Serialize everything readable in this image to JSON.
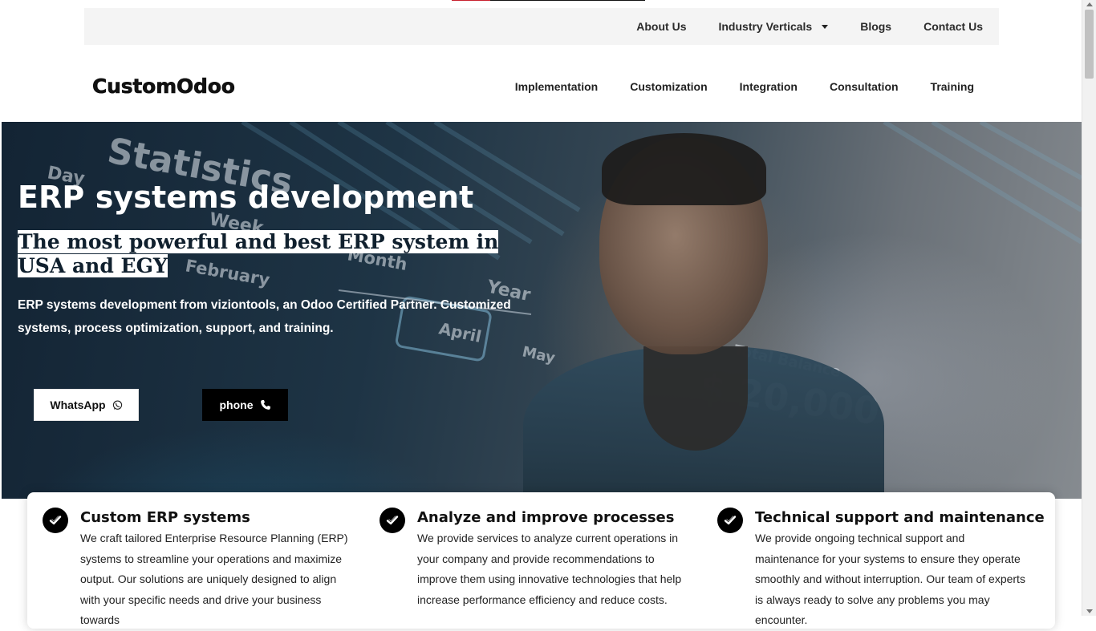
{
  "colors": {
    "primary_black": "#000000",
    "utility_bar_bg": "#f4f4f4",
    "hero_text": "#ffffff",
    "accent_red": "#c8202f"
  },
  "utility_nav": {
    "items": [
      {
        "label": "About Us"
      },
      {
        "label": "Industry Verticals",
        "icon": "caret-down-icon"
      },
      {
        "label": "Blogs"
      },
      {
        "label": "Contact Us"
      }
    ]
  },
  "header": {
    "logo_text": "CustomOdoo",
    "nav": [
      {
        "label": "Implementation"
      },
      {
        "label": "Customization"
      },
      {
        "label": "Integration"
      },
      {
        "label": "Consultation"
      },
      {
        "label": "Training"
      }
    ]
  },
  "hero": {
    "title": "ERP systems development",
    "subtitle": "The most powerful and best ERP system in USA and EGY",
    "description": "ERP systems development from viziontools, an Odoo Certified Partner. Customized systems, process optimization, support, and training.",
    "background_words": [
      "Statistics",
      "Day",
      "Week",
      "February",
      "Month",
      "Year",
      "April",
      "May",
      "Total Balance",
      "$ 20,000"
    ],
    "buttons": [
      {
        "label": "WhatsApp",
        "icon": "whatsapp-icon"
      },
      {
        "label": "phone",
        "icon": "phone-icon"
      }
    ]
  },
  "features": [
    {
      "icon": "check-badge-icon",
      "title": "Custom ERP systems",
      "text": "We craft tailored Enterprise Resource Planning (ERP) systems to streamline your operations and maximize output. Our solutions are uniquely designed to align with your specific needs and drive your business towards"
    },
    {
      "icon": "check-badge-icon",
      "title": "Analyze and improve processes",
      "text": "We provide services to analyze current operations in your company and provide recommendations to improve them using innovative technologies that help increase performance efficiency and reduce costs."
    },
    {
      "icon": "check-badge-icon",
      "title": "Technical support and maintenance",
      "text": "We provide ongoing technical support and maintenance for your systems to ensure they operate smoothly and without interruption. Our team of experts is always ready to solve any problems you may encounter."
    }
  ]
}
